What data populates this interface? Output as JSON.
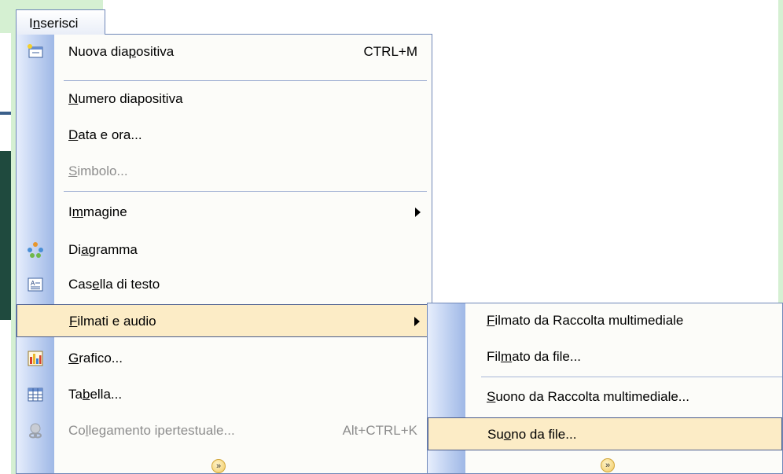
{
  "menu_title": {
    "before": "I",
    "underlined": "n",
    "after": "serisci"
  },
  "menu_items": [
    {
      "pre": "Nuova dia",
      "ul": "p",
      "post": "ositiva",
      "shortcut": "CTRL+M",
      "icon": "new-slide-icon"
    },
    {
      "pre": "",
      "ul": "N",
      "post": "umero diapositiva",
      "shortcut": "",
      "icon": ""
    },
    {
      "pre": "",
      "ul": "D",
      "post": "ata e ora...",
      "shortcut": "",
      "icon": ""
    },
    {
      "pre": "",
      "ul": "S",
      "post": "imbolo...",
      "shortcut": "",
      "icon": "",
      "disabled": true
    },
    {
      "pre": "I",
      "ul": "m",
      "post": "magine",
      "shortcut": "",
      "icon": "",
      "submenu": true
    },
    {
      "pre": "Di",
      "ul": "a",
      "post": "gramma",
      "shortcut": "",
      "icon": "diagram-icon"
    },
    {
      "pre": "Cas",
      "ul": "e",
      "post": "lla di testo",
      "shortcut": "",
      "icon": "text-box-icon"
    },
    {
      "pre": "",
      "ul": "F",
      "post": "ilmati e audio",
      "shortcut": "",
      "icon": "",
      "submenu": true,
      "highlighted": true
    },
    {
      "pre": "",
      "ul": "G",
      "post": "rafico...",
      "shortcut": "",
      "icon": "chart-icon"
    },
    {
      "pre": "Ta",
      "ul": "b",
      "post": "ella...",
      "shortcut": "",
      "icon": "table-icon"
    },
    {
      "pre": "Co",
      "ul": "l",
      "post": "legamento ipertestuale...",
      "shortcut": "Alt+CTRL+K",
      "icon": "hyperlink-icon",
      "disabled": true
    }
  ],
  "submenu_items": [
    {
      "pre": "",
      "ul": "F",
      "post": "ilmato da Raccolta multimediale"
    },
    {
      "pre": "Fil",
      "ul": "m",
      "post": "ato da file..."
    },
    {
      "pre": "",
      "ul": "S",
      "post": "uono da Raccolta multimediale..."
    },
    {
      "pre": "Su",
      "ul": "o",
      "post": "no da file...",
      "highlighted": true
    }
  ],
  "expand_glyph": "»",
  "colors": {
    "highlight_bg": "#fcecc6",
    "highlight_border": "#4a5c8c",
    "menu_border": "#6f87b8",
    "background_green": "#d5f0d2",
    "disabled_text": "#8d8d8d"
  }
}
